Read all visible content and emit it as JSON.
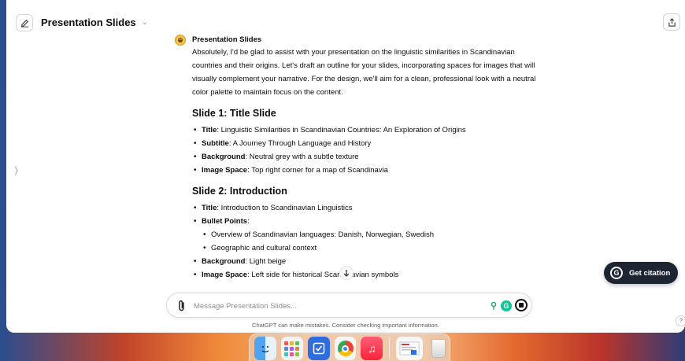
{
  "window": {
    "title": "Presentation Slides",
    "title_chevron": "⌄"
  },
  "message": {
    "author": "Presentation Slides",
    "intro": "Absolutely, I'd be glad to assist with your presentation on the linguistic similarities in Scandinavian countries and their origins. Let's draft an outline for your slides, incorporating spaces for images that will visually complement your narrative. For the design, we'll aim for a clean, professional look with a neutral color palette to maintain focus on the content.",
    "slides": [
      {
        "heading": "Slide 1: Title Slide",
        "items": [
          {
            "label": "Title",
            "text": ": Linguistic Similarities in Scandinavian Countries: An Exploration of Origins"
          },
          {
            "label": "Subtitle",
            "text": ": A Journey Through Language and History"
          },
          {
            "label": "Background",
            "text": ": Neutral grey with a subtle texture"
          },
          {
            "label": "Image Space",
            "text": ": Top right corner for a map of Scandinavia"
          }
        ]
      },
      {
        "heading": "Slide 2: Introduction",
        "items": [
          {
            "label": "Title",
            "text": ": Introduction to Scandinavian Linguistics"
          },
          {
            "label": "Bullet Points",
            "text": ":"
          },
          {
            "sub": "Overview of Scandinavian languages: Danish, Norwegian, Swedish"
          },
          {
            "sub": "Geographic and cultural context"
          },
          {
            "label": "Background",
            "text": ": Light beige"
          },
          {
            "label": "Image Space",
            "text": ": Left side for historical Scandinavian symbols"
          }
        ]
      }
    ]
  },
  "composer": {
    "placeholder": "Message Presentation Slides..."
  },
  "disclaimer": "ChatGPT can make mistakes. Consider checking important information.",
  "citation_button": "Get citation",
  "help_label": "?",
  "icons": {
    "new_chat": "edit-icon",
    "share": "share-icon",
    "attach": "paperclip-icon",
    "stop": "stop-icon",
    "scroll_down": "arrow-down-icon"
  },
  "colors": {
    "citation_bg": "#1d2533",
    "grammarly": "#15c39a",
    "text": "#0d0d0d"
  }
}
